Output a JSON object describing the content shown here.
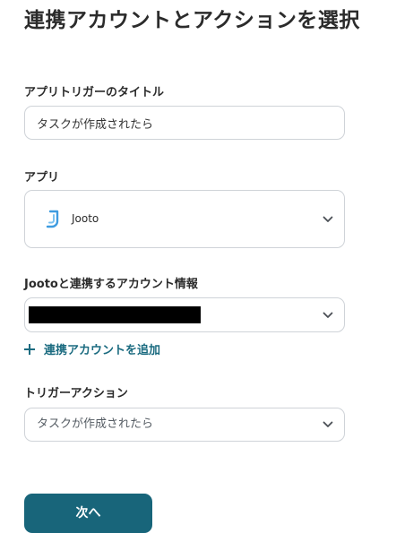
{
  "page": {
    "title": "連携アカウントとアクションを選択"
  },
  "form": {
    "trigger_title": {
      "label": "アプリトリガーのタイトル",
      "value": "タスクが作成されたら"
    },
    "app": {
      "label": "アプリ",
      "selected": "Jooto",
      "icon": "jooto-logo-icon",
      "icon_color": "#3d9be0"
    },
    "account": {
      "label": "Jootoと連携するアカウント情報",
      "add_link": "連携アカウントを追加"
    },
    "trigger_action": {
      "label": "トリガーアクション",
      "selected": "タスクが作成されたら"
    }
  },
  "actions": {
    "next_label": "次へ",
    "next_color": "#18657a",
    "link_color": "#1b6b80"
  }
}
